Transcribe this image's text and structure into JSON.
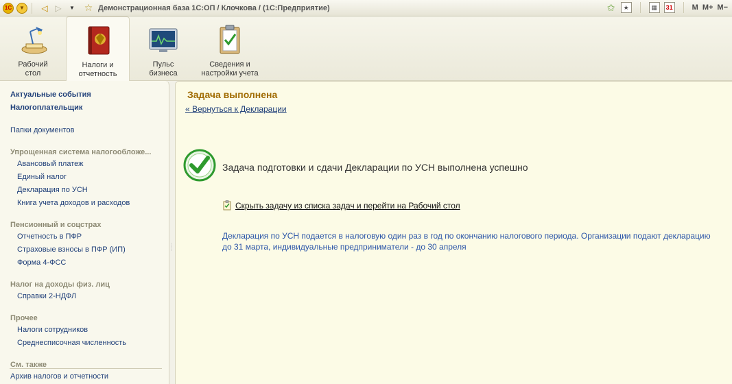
{
  "titlebar": {
    "title": "Демонстрационная база 1С:ОП / Клочкова /  (1С:Предприятие)",
    "logo": "1С",
    "m_label": "M",
    "m_plus_label": "M+",
    "m_minus_label": "M−",
    "calendar_day": "31"
  },
  "sections": [
    {
      "label": "Рабочий\nстол",
      "icon": "desk-lamp-icon"
    },
    {
      "label": "Налоги и\nотчетность",
      "icon": "book-icon"
    },
    {
      "label": "Пульс\nбизнеса",
      "icon": "monitor-chart-icon"
    },
    {
      "label": "Сведения и\nнастройки учета",
      "icon": "clipboard-icon"
    }
  ],
  "sidebar": {
    "events": "Актуальные события",
    "taxpayer": "Налогоплательщик",
    "folders": "Папки документов",
    "usn_group": "Упрощенная система налогообложе...",
    "usn_items": [
      "Авансовый платеж",
      "Единый налог",
      "Декларация по УСН",
      "Книга учета доходов и расходов"
    ],
    "pension_group": "Пенсионный и соцстрах",
    "pension_items": [
      "Отчетность в ПФР",
      "Страховые взносы в ПФР (ИП)",
      "Форма 4-ФСС"
    ],
    "ndfl_group": "Налог на доходы физ. лиц",
    "ndfl_items": [
      "Справки  2-НДФЛ"
    ],
    "other_group": "Прочее",
    "other_items": [
      "Налоги сотрудников",
      "Среднесписочная численность"
    ],
    "see_also_group": "См. также",
    "see_also_items": [
      "Архив налогов и отчетности"
    ]
  },
  "main": {
    "title": "Задача выполнена",
    "back_link": "« Вернуться к Декларации",
    "success_message": "Задача подготовки и сдачи Декларации по УСН выполнена успешно",
    "hide_task_link": "Скрыть задачу из списка задач и перейти на Рабочий стол",
    "info": "Декларация по УСН подается в налоговую один раз в год по окончанию налогового периода. Организации подают декларацию до 31 марта, индивидуальные предприниматели - до 30 апреля"
  },
  "colors": {
    "title_accent": "#a06b00",
    "link": "#1f3f79",
    "info_text": "#2b55a8",
    "success_green": "#2e9a2e"
  }
}
